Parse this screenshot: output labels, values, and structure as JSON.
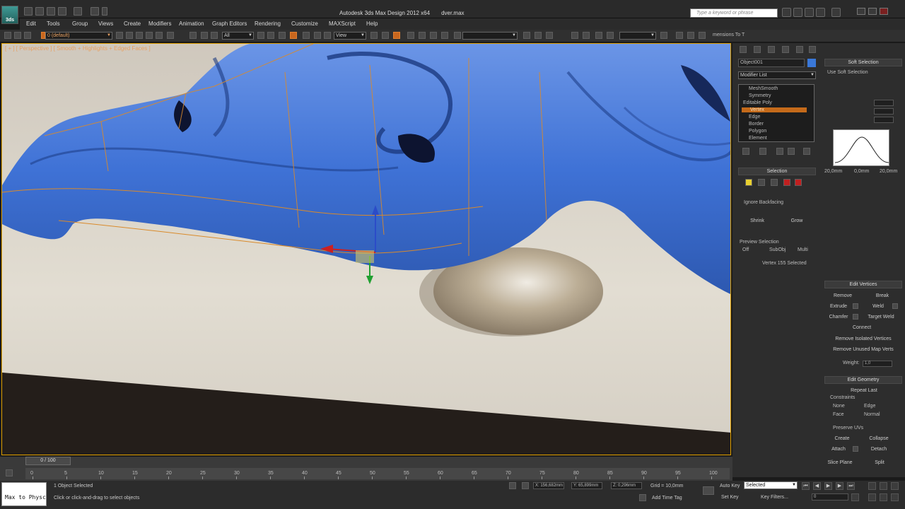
{
  "app": {
    "logo": "3ds",
    "title": "Autodesk 3ds Max Design 2012 x64",
    "file": "dver.max",
    "search_placeholder": "Type a keyword or phrase"
  },
  "menu": [
    "Edit",
    "Tools",
    "Group",
    "Views",
    "Create",
    "Modifiers",
    "Animation",
    "Graph Editors",
    "Rendering",
    "Customize",
    "MAXScript",
    "Help"
  ],
  "toolbar": {
    "layer": "0 (default)",
    "filter": "All",
    "ref_coord": "View",
    "selset": "",
    "dims_label": "mensions To T"
  },
  "viewport": {
    "label": "[ + ] [ Perspective ] [ Smooth + Highlights + Edged Faces ]"
  },
  "command_panel": {
    "object_name": "Object001",
    "modifier_list": "Modifier List",
    "stack": [
      "MeshSmooth",
      "Symmetry",
      "Editable Poly",
      "Vertex",
      "Edge",
      "Border",
      "Polygon",
      "Element"
    ],
    "selection": {
      "title": "Selection",
      "ignore_backfacing": "Ignore Backfacing",
      "shrink": "Shrink",
      "grow": "Grow",
      "preview_selection": "Preview Selection",
      "off": "Off",
      "subobj": "SubObj",
      "multi": "Multi",
      "status": "Vertex 155 Selected"
    },
    "soft_selection": {
      "title": "Soft Selection",
      "use_soft_selection": "Use Soft Selection",
      "curve_labels": [
        "20,0mm",
        "0,0mm",
        "20,0mm"
      ]
    },
    "edit_vertices": {
      "title": "Edit Vertices",
      "remove": "Remove",
      "break": "Break",
      "extrude": "Extrude",
      "weld": "Weld",
      "chamfer": "Chamfer",
      "target_weld": "Target Weld",
      "connect": "Connect",
      "remove_isolated": "Remove Isolated Vertices",
      "remove_unused": "Remove Unused Map Verts",
      "weight_label": "Weight:",
      "weight_value": "1,0"
    },
    "edit_geometry": {
      "title": "Edit Geometry",
      "repeat_last": "Repeat Last",
      "constraints": "Constraints",
      "none": "None",
      "edge": "Edge",
      "face": "Face",
      "normal": "Normal",
      "preserve_uvs": "Preserve UVs",
      "create": "Create",
      "collapse": "Collapse",
      "attach": "Attach",
      "detach": "Detach",
      "slice_plane": "Slice Plane",
      "split": "Split"
    }
  },
  "timeline": {
    "frame": "0 / 100",
    "ticks": [
      "0",
      "5",
      "10",
      "15",
      "20",
      "25",
      "30",
      "35",
      "40",
      "45",
      "50",
      "55",
      "60",
      "65",
      "70",
      "75",
      "80",
      "85",
      "90",
      "95",
      "100"
    ]
  },
  "status": {
    "maxscript": "Max to Physc",
    "selected": "1 Object Selected",
    "prompt": "Click or click-and-drag to select objects",
    "x": "X: 156,682mm",
    "y": "Y: 65,899mm",
    "z": "Z: 0,296mm",
    "grid": "Grid = 10,0mm",
    "add_time_tag": "Add Time Tag",
    "auto_key": "Auto Key",
    "selected_dropdown": "Selected",
    "set_key": "Set Key",
    "key_filters": "Key Filters...",
    "frame_value": "0"
  }
}
